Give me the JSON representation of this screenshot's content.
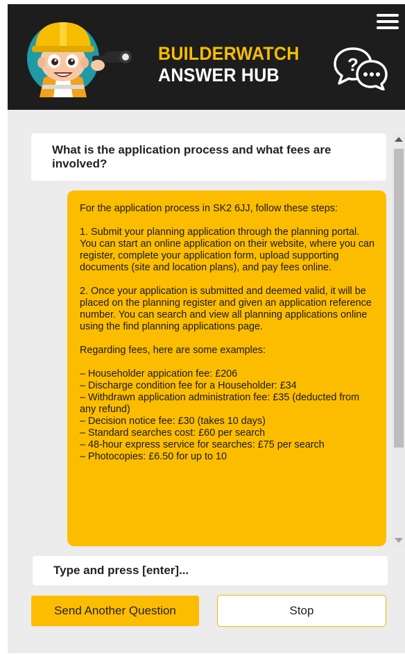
{
  "header": {
    "brand_line1": "BUILDERWATCH",
    "brand_line2": "ANSWER HUB",
    "menu_icon": "hamburger-menu-icon",
    "chat_icon": "question-chat-bubbles-icon",
    "mascot_icon": "builder-mascot-with-binoculars-icon"
  },
  "question": {
    "text": "What is the application process and what fees are involved?"
  },
  "answer": {
    "intro": "For the application process in SK2 6JJ, follow these steps:",
    "step1": "1. Submit your planning application through the planning portal. You can start an online application on their website, where you can register, complete your application form, upload supporting documents (site and location plans), and pay fees online.",
    "step2": "2. Once your application is submitted and deemed valid, it will be placed on the planning register and given an application reference number. You can search and view all planning applications online using the find planning applications page.",
    "fees_intro": "Regarding fees, here are some examples:",
    "fees": [
      "– Householder appication fee: £206",
      "– Discharge condition fee for a Householder: £34",
      "– Withdrawn application administration fee: £35 (deducted from any refund)",
      "– Decision notice fee: £30 (takes 10 days)",
      "– Standard searches cost: £60 per search",
      "– 48-hour express service for searches: £75 per search",
      "– Photocopies: £6.50 for up to 10"
    ]
  },
  "input": {
    "placeholder": "Type and press [enter]..."
  },
  "buttons": {
    "send_label": "Send Another Question",
    "stop_label": "Stop"
  },
  "colors": {
    "accent": "#fcbd00",
    "header_bg": "#1d1d1d",
    "background": "#ececec"
  }
}
